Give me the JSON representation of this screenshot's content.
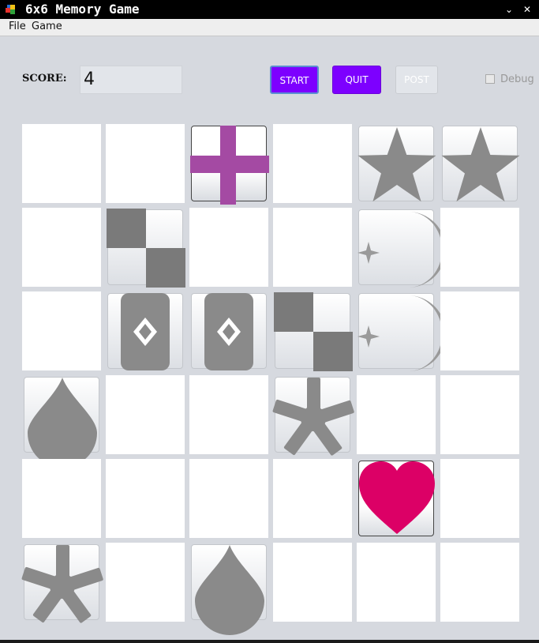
{
  "window": {
    "title": "6x6 Memory Game",
    "icons": {
      "app": "puzzle-icon",
      "minimize": "chevron-down-icon",
      "close": "close-icon"
    }
  },
  "menu": [
    "File",
    "Game"
  ],
  "toolbar": {
    "score_label": "SCORE:",
    "score_value": "4",
    "start_label": "START",
    "quit_label": "QUIT",
    "post_label": "POST",
    "debug_label": "Debug",
    "debug_checked": false
  },
  "colors": {
    "accent": "#7d00ff",
    "cross": "#a44aa3",
    "heart": "#dc0066",
    "shape_gray": "#8a8a8a"
  },
  "board": {
    "rows": 6,
    "cols": 6,
    "cells": [
      [
        "blank",
        "blank",
        "cross-active",
        "blank",
        "star",
        "star"
      ],
      [
        "blank",
        "checker",
        "blank",
        "blank",
        "moon-star",
        "blank"
      ],
      [
        "blank",
        "card",
        "card",
        "checker",
        "moon-star",
        "blank"
      ],
      [
        "drop",
        "blank",
        "blank",
        "asterisk",
        "blank",
        "blank"
      ],
      [
        "blank",
        "blank",
        "blank",
        "blank",
        "heart-active",
        "blank"
      ],
      [
        "asterisk",
        "blank",
        "drop",
        "blank",
        "blank",
        "blank"
      ]
    ]
  }
}
